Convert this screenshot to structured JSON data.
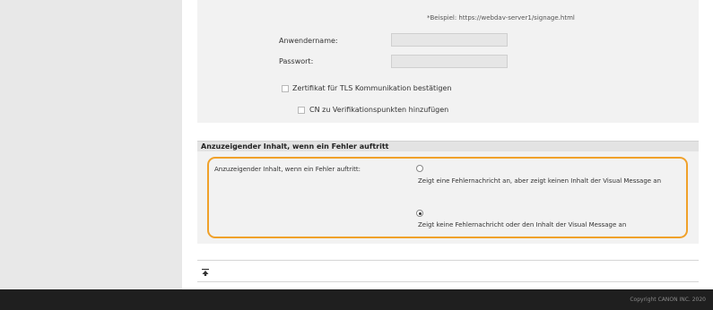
{
  "form": {
    "example_hint": "*Beispiel: https://webdav-server1/signage.html",
    "username_label": "Anwendername:",
    "username_value": "",
    "password_label": "Passwort:",
    "password_value": "",
    "tls_checkbox_label": "Zertifikat für TLS Kommunikation bestätigen",
    "tls_checked": false,
    "cn_checkbox_label": "CN zu Verifikationspunkten hinzufügen",
    "cn_checked": false
  },
  "error_section": {
    "title": "Anzuzeigender Inhalt, wenn ein Fehler auftritt",
    "field_label": "Anzuzeigender Inhalt, wenn ein Fehler auftritt:",
    "options": [
      {
        "label": "Zeigt eine Fehlernachricht an, aber zeigt keinen Inhalt der Visual Message an",
        "checked": false
      },
      {
        "label": "Zeigt keine Fehlernachricht oder den Inhalt der Visual Message an",
        "checked": true
      }
    ],
    "highlight_color": "#f0a12a"
  },
  "footer": {
    "copyright": "Copyright CANON INC. 2020"
  }
}
